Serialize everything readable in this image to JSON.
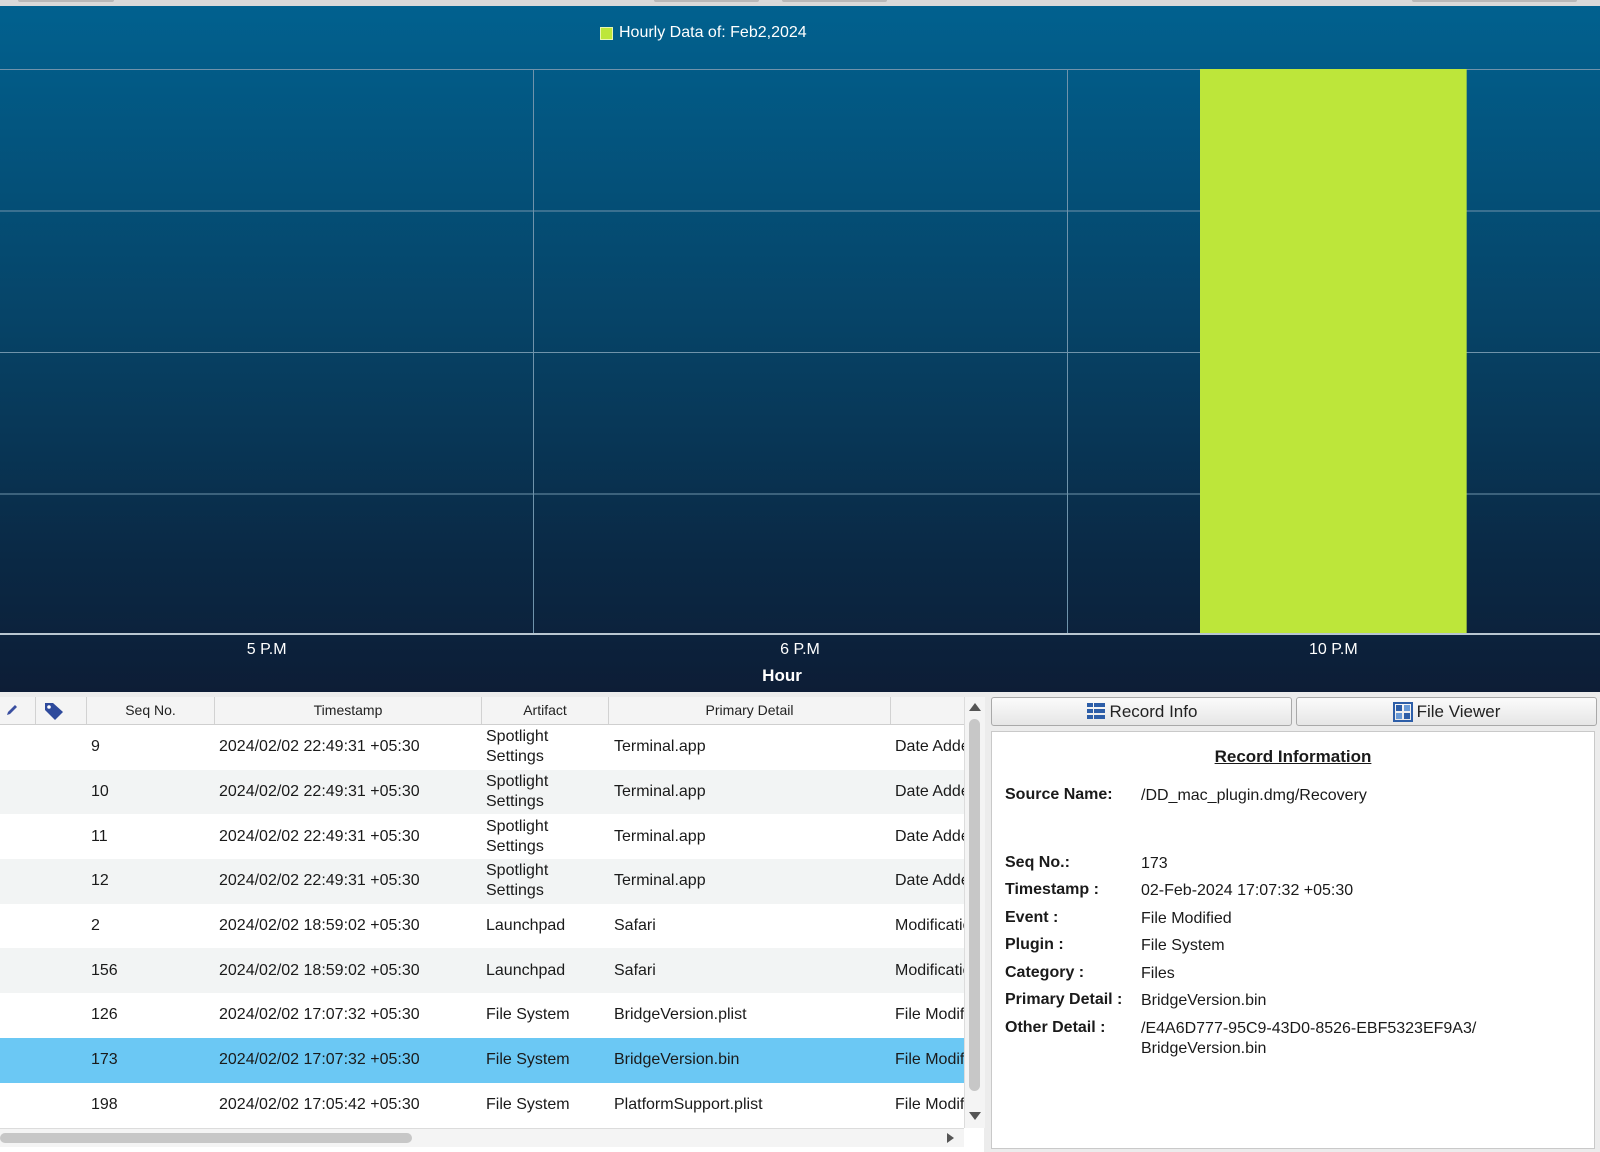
{
  "chart_data": {
    "type": "bar",
    "legend": "Hourly Data of: Feb2,2024",
    "categories": [
      "5 P.M",
      "6 P.M",
      "10 P.M"
    ],
    "series": [
      {
        "name": "Hourly Data of: Feb2,2024",
        "values": [
          0,
          0,
          1
        ]
      }
    ],
    "xlabel": "Hour",
    "ylabel": "",
    "ylim": [
      0,
      1
    ],
    "grid": true,
    "colors": {
      "bar": "#bde63a",
      "grid": "#6f93ab",
      "axis": "#b9c6d0"
    }
  },
  "table": {
    "headers": {
      "edit_icon": "edit-icon",
      "tag_icon": "tag-icon",
      "seq": "Seq No.",
      "timestamp": "Timestamp",
      "artifact": "Artifact",
      "primary": "Primary Detail"
    },
    "rows": [
      {
        "seq": "9",
        "timestamp": "2024/02/02 22:49:31 +05:30",
        "artifact": "Spotlight Settings",
        "primary": "Terminal.app",
        "event": "Date Added"
      },
      {
        "seq": "10",
        "timestamp": "2024/02/02 22:49:31 +05:30",
        "artifact": "Spotlight Settings",
        "primary": "Terminal.app",
        "event": "Date Added"
      },
      {
        "seq": "11",
        "timestamp": "2024/02/02 22:49:31 +05:30",
        "artifact": "Spotlight Settings",
        "primary": "Terminal.app",
        "event": "Date Added"
      },
      {
        "seq": "12",
        "timestamp": "2024/02/02 22:49:31 +05:30",
        "artifact": "Spotlight Settings",
        "primary": "Terminal.app",
        "event": "Date Added"
      },
      {
        "seq": "2",
        "timestamp": "2024/02/02 18:59:02 +05:30",
        "artifact": "Launchpad",
        "primary": "Safari",
        "event": "Modification"
      },
      {
        "seq": "156",
        "timestamp": "2024/02/02 18:59:02 +05:30",
        "artifact": "Launchpad",
        "primary": "Safari",
        "event": "Modification"
      },
      {
        "seq": "126",
        "timestamp": "2024/02/02 17:07:32 +05:30",
        "artifact": "File System",
        "primary": "BridgeVersion.plist",
        "event": "File Modified"
      },
      {
        "seq": "173",
        "timestamp": "2024/02/02 17:07:32 +05:30",
        "artifact": "File System",
        "primary": "BridgeVersion.bin",
        "event": "File Modified",
        "selected": true
      },
      {
        "seq": "198",
        "timestamp": "2024/02/02 17:05:42 +05:30",
        "artifact": "File System",
        "primary": "PlatformSupport.plist",
        "event": "File Modified"
      }
    ]
  },
  "right_panel": {
    "tabs": {
      "record_info": "Record Info",
      "file_viewer": "File Viewer"
    },
    "title": "Record Information",
    "fields": {
      "source_label": "Source Name:",
      "source_value": "/DD_mac_plugin.dmg/Recovery",
      "seq_label": "Seq No.:",
      "seq_value": "173",
      "timestamp_label": "Timestamp :",
      "timestamp_value": "02-Feb-2024 17:07:32 +05:30",
      "event_label": "Event :",
      "event_value": "File Modified",
      "plugin_label": "Plugin :",
      "plugin_value": "File System",
      "category_label": "Category :",
      "category_value": "Files",
      "primary_label": "Primary Detail :",
      "primary_value": "BridgeVersion.bin",
      "other_label": "Other Detail :",
      "other_value_1": "/E4A6D777-95C9-43D0-8526-EBF5323EF9A3/",
      "other_value_2": "BridgeVersion.bin"
    }
  }
}
